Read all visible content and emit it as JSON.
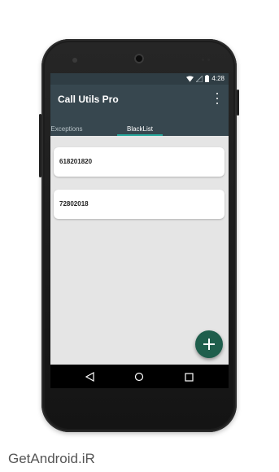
{
  "status_bar": {
    "time": "4:28"
  },
  "app": {
    "title": "Call Utils Pro"
  },
  "tabs": [
    {
      "label": "Exceptions",
      "active": false
    },
    {
      "label": "BlackList",
      "active": true
    }
  ],
  "list": {
    "items": [
      {
        "number": "618201820"
      },
      {
        "number": "72802018"
      }
    ]
  },
  "colors": {
    "appbar": "#37474f",
    "accent": "#26a69a",
    "fab": "#1f5e4c",
    "background": "#e5e5e5"
  },
  "icons": {
    "overflow": "more-vert-icon",
    "fab": "add-icon",
    "back": "back-triangle-icon",
    "home": "home-circle-icon",
    "recents": "recents-square-icon"
  },
  "watermark": {
    "text": "GetAndroid.iR"
  }
}
